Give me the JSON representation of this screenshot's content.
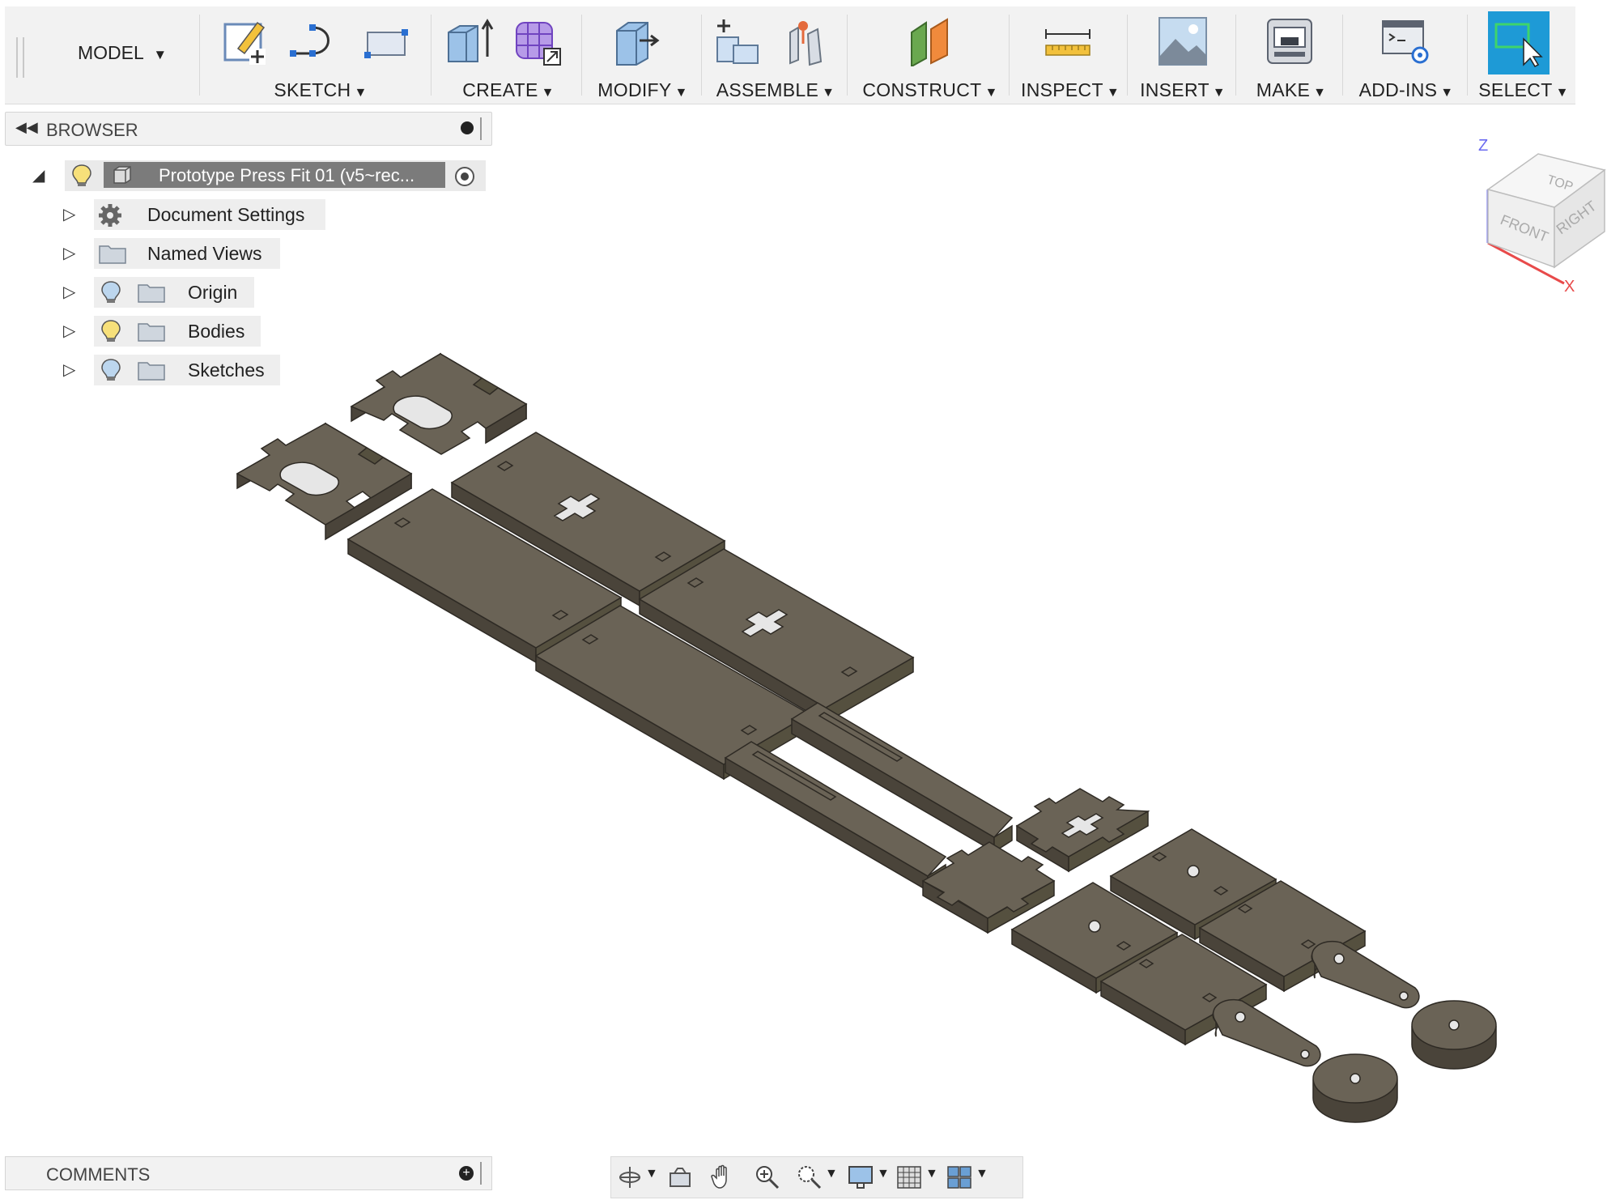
{
  "toolbar": {
    "workspace_label": "MODEL",
    "groups": [
      {
        "label": "SKETCH"
      },
      {
        "label": "CREATE"
      },
      {
        "label": "MODIFY"
      },
      {
        "label": "ASSEMBLE"
      },
      {
        "label": "CONSTRUCT"
      },
      {
        "label": "INSPECT"
      },
      {
        "label": "INSERT"
      },
      {
        "label": "MAKE"
      },
      {
        "label": "ADD-INS"
      },
      {
        "label": "SELECT"
      }
    ],
    "caret": "▼"
  },
  "browser": {
    "title": "BROWSER",
    "root_label": "Prototype Press Fit 01 (v5~rec...",
    "items": [
      {
        "label": "Document Settings",
        "icon": "gear-icon"
      },
      {
        "label": "Named Views",
        "icon": "folder-icon"
      },
      {
        "label": "Origin",
        "icon": "folder-icon"
      },
      {
        "label": "Bodies",
        "icon": "folder-icon"
      },
      {
        "label": "Sketches",
        "icon": "folder-icon"
      }
    ]
  },
  "viewcube": {
    "top": "TOP",
    "front": "FRONT",
    "right": "RIGHT",
    "axis_z": "Z",
    "axis_x": "X"
  },
  "comments": {
    "title": "COMMENTS"
  },
  "colors": {
    "part_top": "#6a6356",
    "part_side": "#4a443a",
    "edge": "#2e2a24",
    "select_blue": "#1e9ad6"
  }
}
